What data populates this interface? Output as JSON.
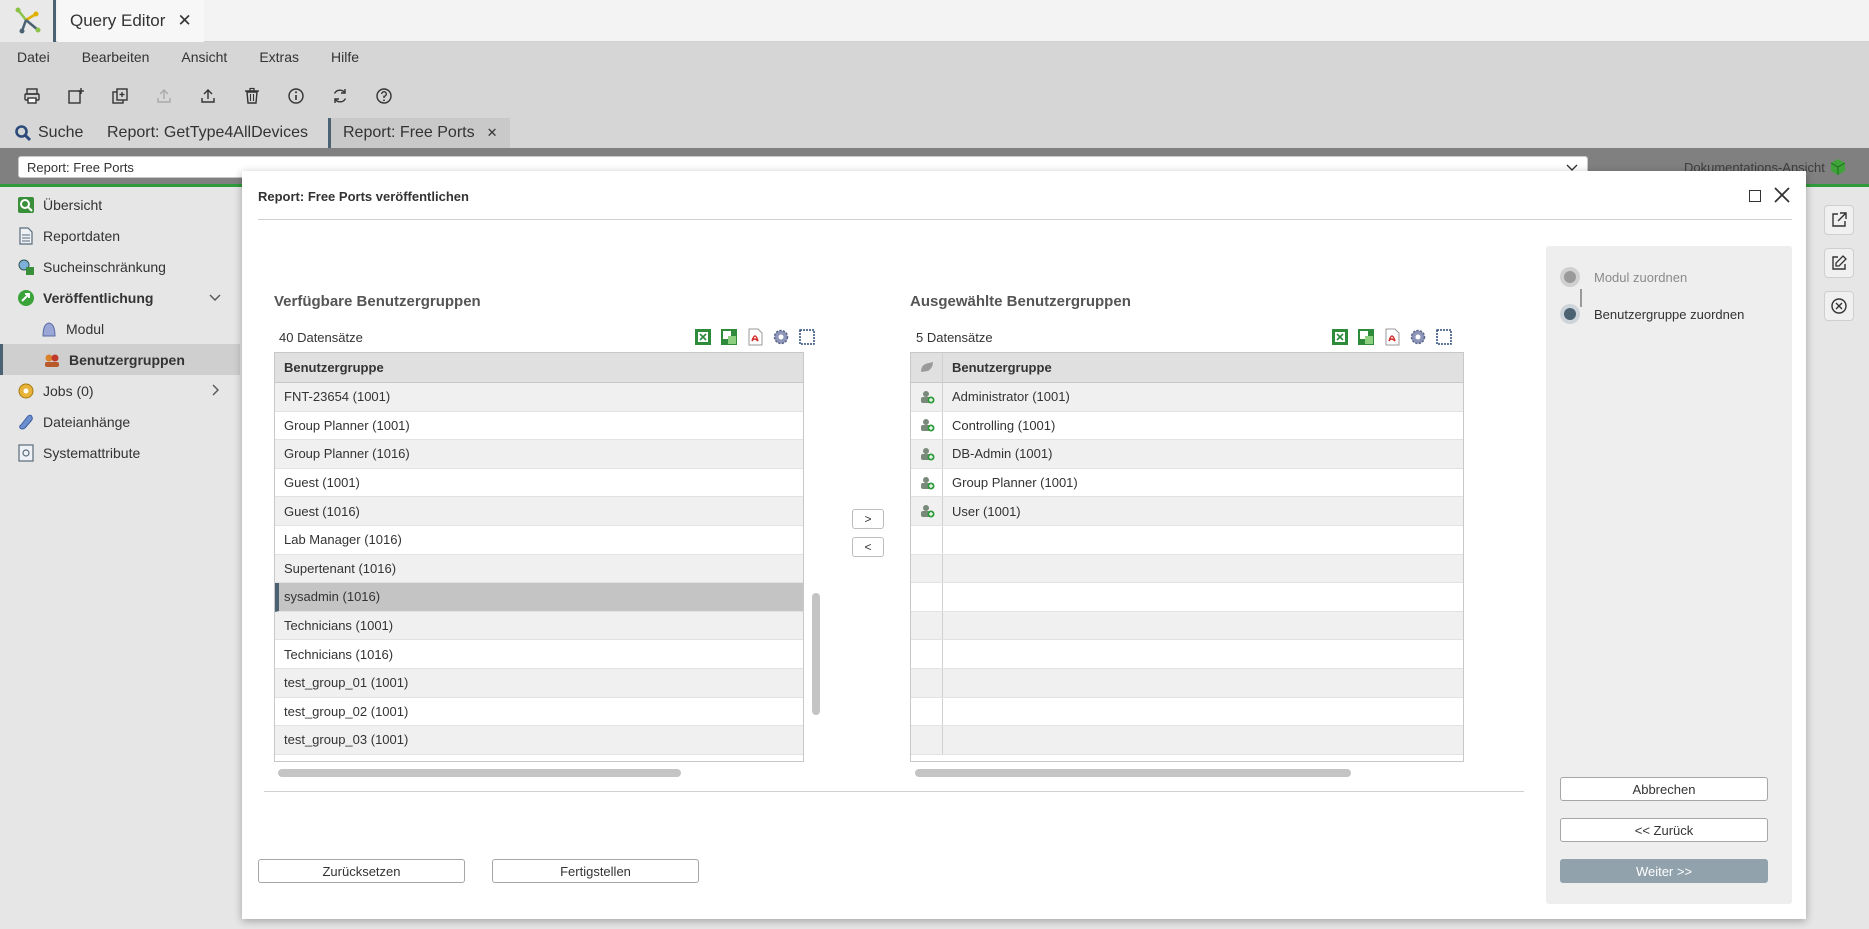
{
  "app": {
    "tab_title": "Query Editor",
    "close_glyph": "✕"
  },
  "menu": [
    "Datei",
    "Bearbeiten",
    "Ansicht",
    "Extras",
    "Hilfe"
  ],
  "toolbar_icons": [
    "print-icon",
    "new-icon",
    "copy-icon",
    "upload-icon",
    "export-icon",
    "delete-icon",
    "info-icon",
    "refresh-icon",
    "help-icon"
  ],
  "doc_tabs": {
    "search": "Suche",
    "tab1": "Report: GetType4AllDevices",
    "tab2": "Report: Free Ports",
    "close_glyph": "✕"
  },
  "selector": {
    "value": "Report: Free Ports",
    "doc_view": "Dokumentations-Ansicht"
  },
  "sidebar": {
    "items": [
      {
        "label": "Übersicht"
      },
      {
        "label": "Reportdaten"
      },
      {
        "label": "Sucheinschränkung"
      },
      {
        "label": "Veröffentlichung"
      },
      {
        "label": "Modul"
      },
      {
        "label": "Benutzergruppen"
      },
      {
        "label": "Jobs (0)"
      },
      {
        "label": "Dateianhänge"
      },
      {
        "label": "Systemattribute"
      }
    ]
  },
  "dialog": {
    "title": "Report: Free Ports veröffentlichen",
    "left": {
      "title": "Verfügbare Benutzergruppen",
      "count": "40 Datensätze",
      "header": "Benutzergruppe",
      "rows": [
        "FNT-23654 (1001)",
        "Group Planner (1001)",
        "Group Planner (1016)",
        "Guest (1001)",
        "Guest (1016)",
        "Lab Manager (1016)",
        "Supertenant (1016)",
        "sysadmin (1016)",
        "Technicians (1001)",
        "Technicians (1016)",
        "test_group_01 (1001)",
        "test_group_02 (1001)",
        "test_group_03 (1001)"
      ]
    },
    "right": {
      "title": "Ausgewählte Benutzergruppen",
      "count": "5 Datensätze",
      "header": "Benutzergruppe",
      "rows": [
        "Administrator (1001)",
        "Controlling (1001)",
        "DB-Admin (1001)",
        "Group Planner (1001)",
        "User (1001)"
      ]
    },
    "move_right": ">",
    "move_left": "<",
    "wizard": {
      "step1": "Modul zuordnen",
      "step2": "Benutzergruppe zuordnen"
    },
    "buttons": {
      "reset": "Zurücksetzen",
      "finish": "Fertigstellen",
      "cancel": "Abbrechen",
      "back": "<< Zurück",
      "next": "Weiter >>"
    }
  },
  "colors": {
    "accent": "#4a6271",
    "green": "#2f9c3b",
    "primary_button": "#91a2ac"
  }
}
